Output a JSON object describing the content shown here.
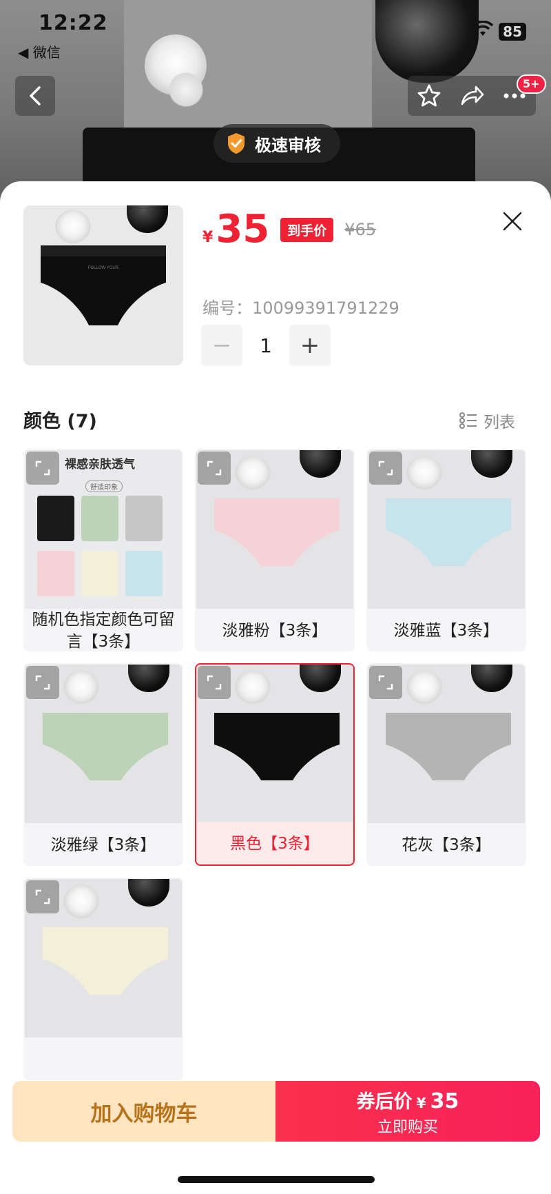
{
  "status_bar": {
    "time": "12:22",
    "back_app": "◀ 微信",
    "battery": "85"
  },
  "nav": {
    "badge": "5+"
  },
  "audit_banner": {
    "label": "极速审核"
  },
  "product": {
    "price_currency": "¥",
    "price": "35",
    "price_tag": "到手价",
    "original_price": "¥65",
    "sku_label": "编号：",
    "sku": "10099391791229",
    "quantity": "1"
  },
  "quantity_controls": {
    "minus": "−",
    "plus": "+"
  },
  "section": {
    "title": "颜色 (7)",
    "list_toggle": "列表"
  },
  "variants": [
    {
      "label": "随机色指定颜色可留言【3条】",
      "color": "#2b2b2b",
      "selected": false,
      "promo": "裸感亲肤透气",
      "promo_sub": "舒适印象"
    },
    {
      "label": "淡雅粉【3条】",
      "color": "#f4d2d6",
      "selected": false
    },
    {
      "label": "淡雅蓝【3条】",
      "color": "#c7e4ec",
      "selected": false
    },
    {
      "label": "淡雅绿【3条】",
      "color": "#bcd3b7",
      "selected": false
    },
    {
      "label": "黑色【3条】",
      "color": "#0e0e0e",
      "selected": true
    },
    {
      "label": "花灰【3条】",
      "color": "#b4b4b4",
      "selected": false
    },
    {
      "label": "",
      "color": "#f4efd8",
      "selected": false
    }
  ],
  "bottom_bar": {
    "add_to_cart": "加入购物车",
    "coupon_price_label": "券后价",
    "coupon_price_currency": "¥",
    "coupon_price": "35",
    "buy_now": "立即购买"
  },
  "colors": {
    "accent": "#ee2233",
    "cart_bg": "#ffe5c2",
    "cart_text": "#b8731a"
  }
}
